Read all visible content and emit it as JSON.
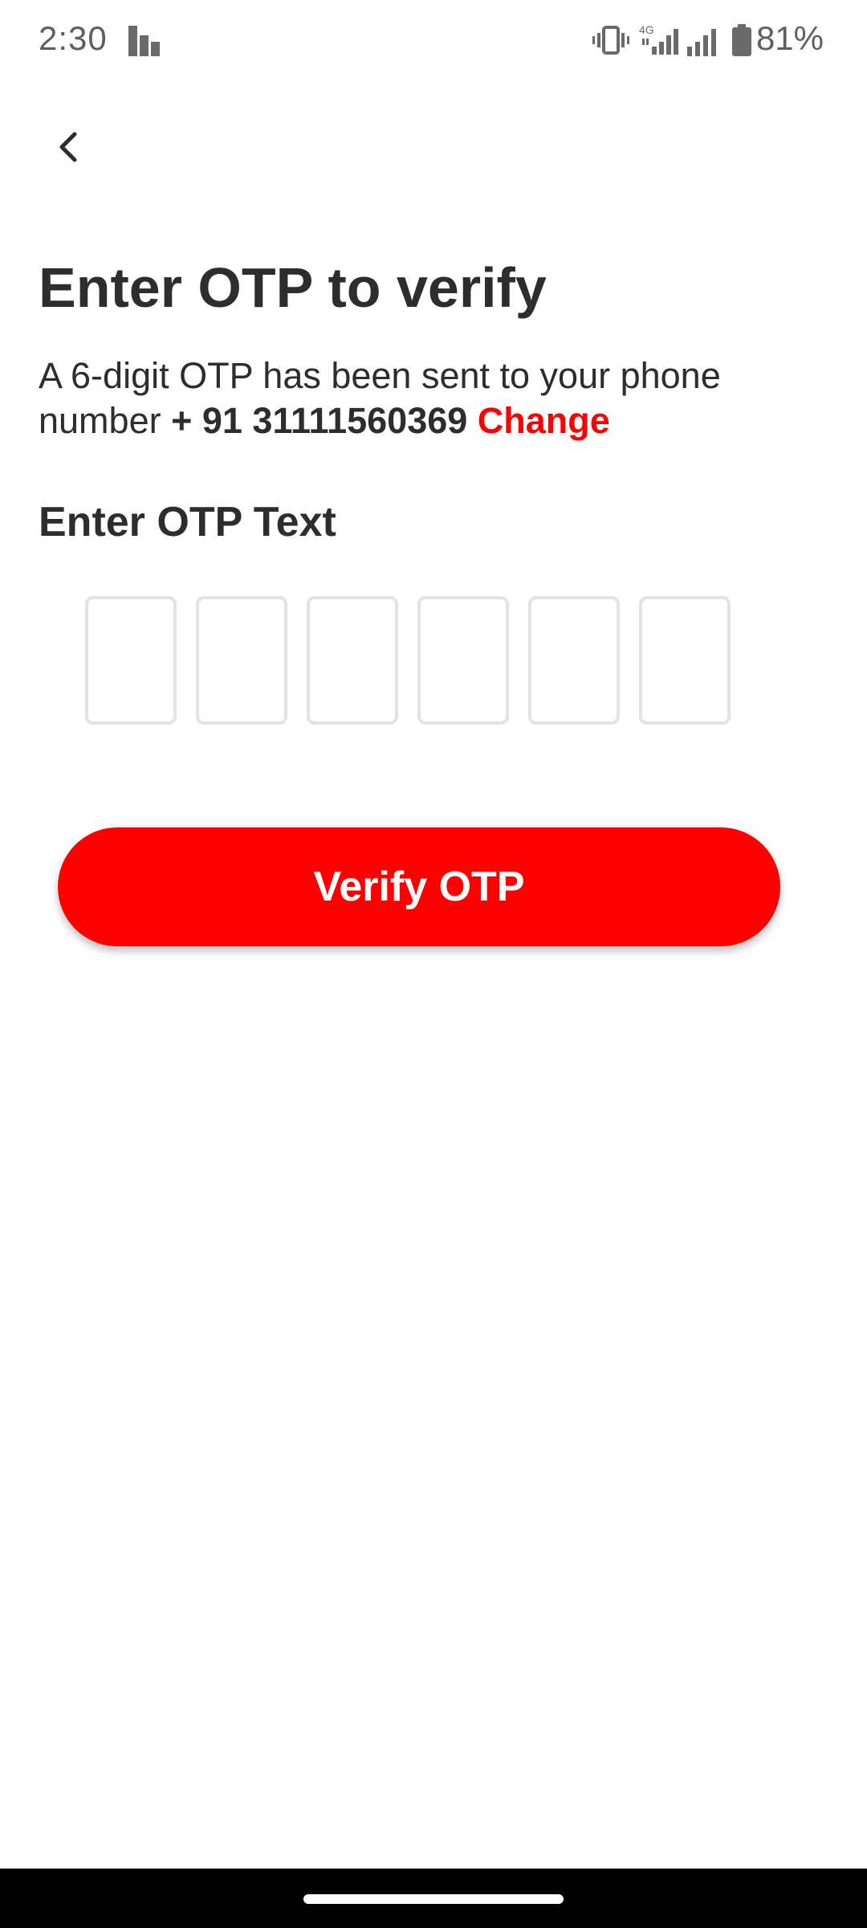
{
  "status_bar": {
    "time": "2:30",
    "battery": "81%",
    "icons": [
      "bar-chart-icon",
      "vibrate-icon",
      "4g-signal-icon",
      "signal-icon",
      "battery-icon"
    ]
  },
  "header": {
    "back_icon": "chevron-left-icon"
  },
  "main": {
    "title": "Enter OTP to verify",
    "subtitle_prefix": "A 6-digit OTP has been sent to your phone number ",
    "phone": "+ 91 31111560369",
    "change_label": "Change",
    "otp_label": "Enter OTP Text",
    "otp_digits": [
      "",
      "",
      "",
      "",
      "",
      ""
    ],
    "verify_label": "Verify OTP"
  },
  "colors": {
    "accent": "#ff0000",
    "text": "#2d2d2d",
    "box_border": "#e3e3e3"
  }
}
